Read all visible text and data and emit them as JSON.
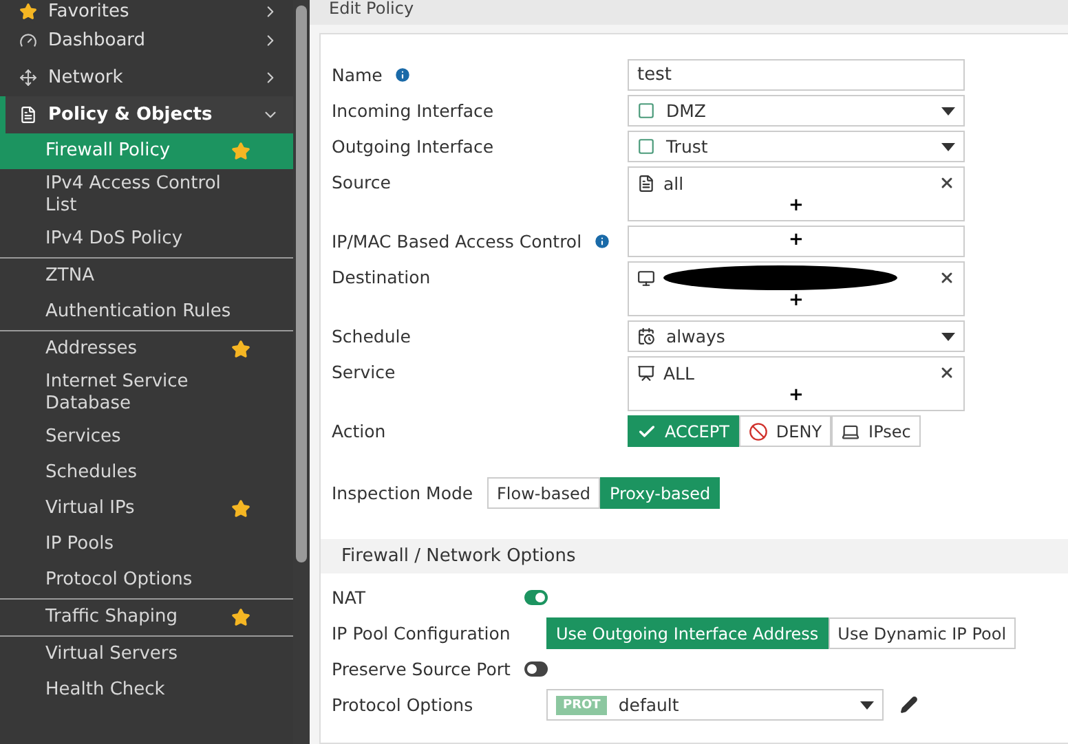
{
  "sidebar": {
    "items": [
      {
        "label": "Favorites",
        "expanded": false
      },
      {
        "label": "Dashboard",
        "expanded": false
      },
      {
        "label": "Network",
        "expanded": false
      },
      {
        "label": "Policy & Objects",
        "expanded": true,
        "groups": [
          [
            {
              "label": "Firewall Policy",
              "favorite": true,
              "selected": true
            },
            {
              "label": "IPv4 Access Control List",
              "favorite": false,
              "selected": false
            },
            {
              "label": "IPv4 DoS Policy",
              "favorite": false,
              "selected": false
            }
          ],
          [
            {
              "label": "ZTNA",
              "favorite": false,
              "selected": false
            },
            {
              "label": "Authentication Rules",
              "favorite": false,
              "selected": false
            }
          ],
          [
            {
              "label": "Addresses",
              "favorite": true,
              "selected": false
            },
            {
              "label": "Internet Service Database",
              "favorite": false,
              "selected": false
            },
            {
              "label": "Services",
              "favorite": false,
              "selected": false
            },
            {
              "label": "Schedules",
              "favorite": false,
              "selected": false
            },
            {
              "label": "Virtual IPs",
              "favorite": true,
              "selected": false
            },
            {
              "label": "IP Pools",
              "favorite": false,
              "selected": false
            },
            {
              "label": "Protocol Options",
              "favorite": false,
              "selected": false
            }
          ],
          [
            {
              "label": "Traffic Shaping",
              "favorite": true,
              "selected": false
            }
          ],
          [
            {
              "label": "Virtual Servers",
              "favorite": false,
              "selected": false
            },
            {
              "label": "Health Check",
              "favorite": false,
              "selected": false
            }
          ]
        ]
      }
    ]
  },
  "page_title": "Edit Policy",
  "fields": [
    {
      "kind": "text",
      "label": "Name",
      "value": "test"
    },
    {
      "kind": "select",
      "label": "Incoming Interface",
      "value": "DMZ"
    },
    {
      "kind": "select",
      "label": "Outgoing Interface",
      "value": "Trust"
    },
    {
      "kind": "multi",
      "label": "Source",
      "value": "all",
      "add": "+"
    },
    {
      "kind": "multi",
      "label": "IP/MAC Based Access Control",
      "add": "+"
    },
    {
      "kind": "multi",
      "label": "Destination",
      "add": "+"
    },
    {
      "kind": "select",
      "label": "Schedule",
      "value": "always"
    },
    {
      "kind": "multi",
      "label": "Service",
      "value": "ALL",
      "add": "+"
    },
    {
      "kind": "action",
      "label": "Action",
      "options": [
        {
          "label": "ACCEPT",
          "selected": true
        },
        {
          "label": "DENY",
          "selected": false
        },
        {
          "label": "IPsec",
          "selected": false
        }
      ]
    },
    {
      "kind": "segmented",
      "label": "Inspection Mode",
      "options": [
        {
          "label": "Flow-based",
          "selected": false
        },
        {
          "label": "Proxy-based",
          "selected": true
        }
      ]
    }
  ],
  "section": {
    "title": "Firewall / Network Options",
    "fields": [
      {
        "kind": "toggle",
        "label": "NAT",
        "on": true
      },
      {
        "kind": "segmented",
        "label": "IP Pool Configuration",
        "options": [
          {
            "label": "Use Outgoing Interface Address",
            "selected": true
          },
          {
            "label": "Use Dynamic IP Pool",
            "selected": false
          }
        ]
      },
      {
        "kind": "toggle",
        "label": "Preserve Source Port",
        "on": false
      },
      {
        "kind": "profile",
        "label": "Protocol Options",
        "badge": "PROT",
        "value": "default"
      }
    ]
  }
}
